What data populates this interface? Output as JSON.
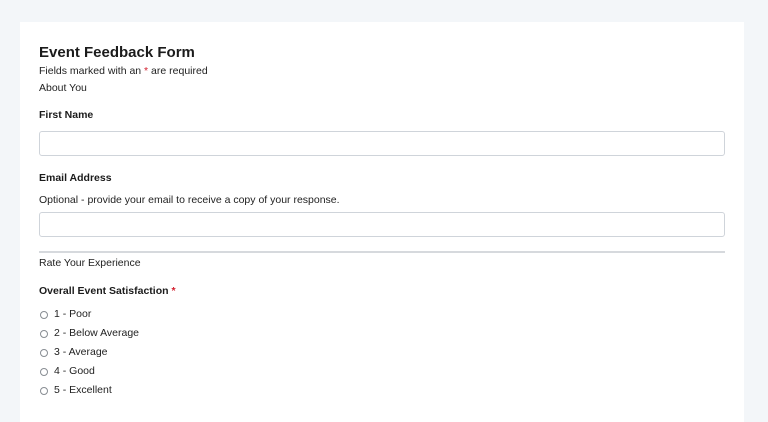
{
  "form": {
    "title": "Event Feedback Form",
    "required_note_prefix": "Fields marked with an ",
    "required_star": "*",
    "required_note_suffix": " are required",
    "accent_required": "#d3202f"
  },
  "section_about": {
    "label": "About You",
    "first_name": {
      "label": "First Name",
      "value": "",
      "placeholder": ""
    },
    "email": {
      "label": "Email Address",
      "help": "Optional - provide your email to receive a copy of your response.",
      "value": "",
      "placeholder": ""
    }
  },
  "section_rate": {
    "label": "Rate Your Experience",
    "satisfaction": {
      "label": "Overall Event Satisfaction",
      "required_star": "*",
      "selected": null,
      "options": [
        "1 - Poor",
        "2 - Below Average",
        "3 - Average",
        "4 - Good",
        "5 - Excellent"
      ]
    }
  }
}
